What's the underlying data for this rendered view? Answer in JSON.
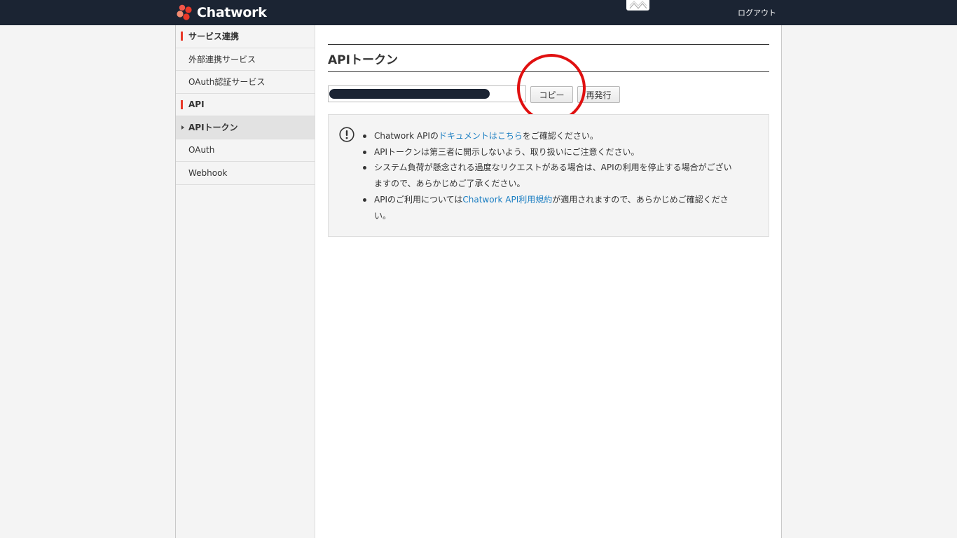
{
  "app": {
    "logo_text": "Chatwork",
    "logout_label": "ログアウト"
  },
  "sidebar": {
    "sections": [
      {
        "heading": "サービス連携",
        "items": [
          {
            "label": "外部連携サービス"
          },
          {
            "label": "OAuth認証サービス"
          }
        ]
      },
      {
        "heading": "API",
        "items": [
          {
            "label": "APIトークン",
            "active": true
          },
          {
            "label": "OAuth"
          },
          {
            "label": "Webhook"
          }
        ]
      }
    ]
  },
  "main": {
    "title": "APIトークン",
    "copy_label": "コピー",
    "reissue_label": "再発行",
    "notice": {
      "items": [
        {
          "before": "Chatwork APIの",
          "link": "ドキュメントはこちら",
          "after": "をご確認ください。"
        },
        {
          "text": "APIトークンは第三者に開示しないよう、取り扱いにご注意ください。"
        },
        {
          "text_l1": "システム負荷が懸念される過度なリクエストがある場合は、APIの利用を停止する場合がござい",
          "text_l2": "ますので、あらかじめご了承ください。"
        },
        {
          "before": "APIのご利用については",
          "link": "Chatwork API利用規約",
          "after_l1": "が適用されますので、あらかじめご確認くださ",
          "after_l2": "い。"
        }
      ]
    }
  },
  "colors": {
    "topbar": "#1b2433",
    "accent_red": "#e83828",
    "link": "#1b7ec2",
    "annotation": "#e01010"
  },
  "icons": {
    "logo": "chatwork-flower-logo",
    "notice": "exclamation-circle-icon"
  }
}
